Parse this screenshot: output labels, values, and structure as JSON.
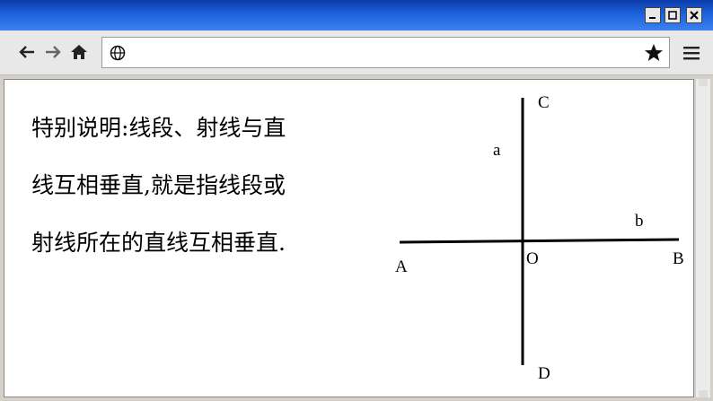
{
  "window": {
    "buttons": {
      "minimize_glyph": "_",
      "maximize_glyph": "□",
      "close_glyph": "×"
    }
  },
  "toolbar": {
    "icons": [
      "back-arrow-icon",
      "forward-arrow-icon",
      "home-icon",
      "globe-icon",
      "star-icon",
      "hamburger-menu-icon"
    ],
    "url": ""
  },
  "content": {
    "note_lines": [
      "特别说明:线段、射线与直",
      "线互相垂直,就是指线段或",
      "射线所在的直线互相垂直."
    ],
    "figure": {
      "point_labels": {
        "C": "C",
        "D": "D",
        "A": "A",
        "B": "B",
        "O": "O"
      },
      "line_labels": {
        "a": "a",
        "b": "b"
      }
    }
  }
}
